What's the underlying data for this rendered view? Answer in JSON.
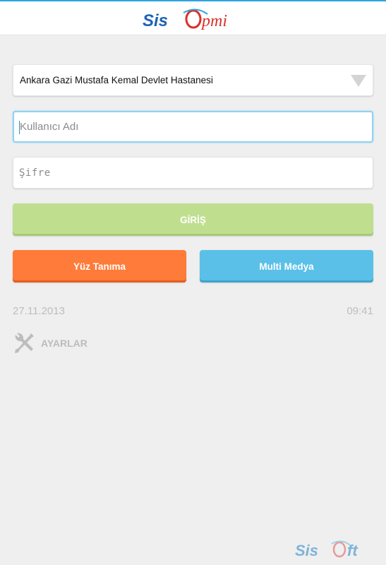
{
  "header": {
    "logo_text_part1": "Sis",
    "logo_text_part2": "pmi"
  },
  "login": {
    "hospital_selected": "Ankara Gazi Mustafa Kemal Devlet Hastanesi",
    "username_placeholder": "Kullanıcı Adı",
    "password_placeholder": "Şifre",
    "login_label": "GİRİŞ",
    "face_label": "Yüz Tanıma",
    "media_label": "Multi Medya"
  },
  "status": {
    "date": "27.11.2013",
    "time": "09:41"
  },
  "settings": {
    "label": "AYARLAR"
  },
  "footer": {
    "brand_part1": "Sis",
    "brand_part2": "ft"
  },
  "colors": {
    "login_button": "#bfdf8f",
    "face_button": "#ff7b39",
    "media_button": "#5bc0e7",
    "logo_blue": "#1f63b5",
    "logo_red": "#d9322a",
    "accent": "#2aa6e0"
  }
}
